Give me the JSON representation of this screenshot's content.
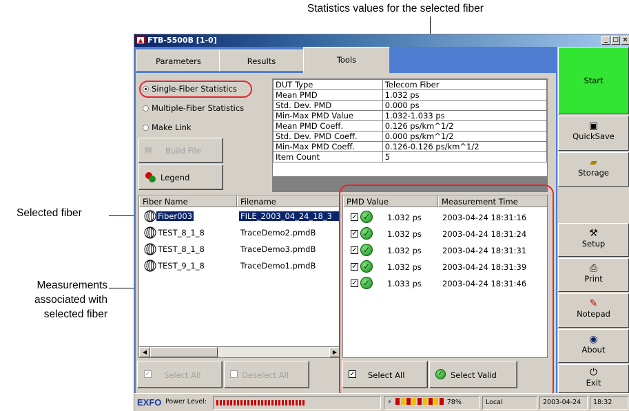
{
  "annotations": {
    "top": "Statistics values for the selected fiber",
    "selected_fiber": "Selected fiber",
    "measurements": [
      "Measurements",
      "associated with",
      "selected fiber"
    ]
  },
  "window": {
    "title": "FTB-5500B [1-0]",
    "app_icon": "exfo-app-icon",
    "controls": [
      "_",
      "□",
      "×"
    ]
  },
  "tabs": [
    {
      "label": "Parameters",
      "active": false
    },
    {
      "label": "Results",
      "active": false
    },
    {
      "label": "Tools",
      "active": true
    }
  ],
  "options": {
    "single": "Single-Fiber Statistics",
    "multiple": "Multiple-Fiber Statistics",
    "link": "Make Link",
    "selected": "single"
  },
  "buttons": {
    "build_file": "Build File",
    "legend": "Legend",
    "select_all_left": "Select All",
    "deselect_all": "Deselect All",
    "select_all": "Select All",
    "select_valid": "Select Valid"
  },
  "stats": [
    {
      "key": "DUT Type",
      "value": "Telecom Fiber"
    },
    {
      "key": "Mean PMD",
      "value": "1.032 ps"
    },
    {
      "key": "Std. Dev. PMD",
      "value": "0.000 ps"
    },
    {
      "key": "Min-Max PMD Value",
      "value": "1.032-1.033 ps"
    },
    {
      "key": "Mean PMD Coeff.",
      "value": "0.126 ps/km^1/2"
    },
    {
      "key": "Std. Dev. PMD Coeff.",
      "value": "0.000 ps/km^1/2"
    },
    {
      "key": "Min-Max PMD Coeff.",
      "value": "0.126-0.126 ps/km^1/2"
    },
    {
      "key": "Item Count",
      "value": "5"
    }
  ],
  "fiber_list": {
    "headers": [
      "Fiber Name",
      "Filename"
    ],
    "rows": [
      {
        "name": "Fiber003",
        "file": "FILE_2003_04_24_18_3",
        "selected": true
      },
      {
        "name": "TEST_8_1_8",
        "file": "TraceDemo2.pmdB",
        "selected": false
      },
      {
        "name": "TEST_8_1_8",
        "file": "TraceDemo3.pmdB",
        "selected": false
      },
      {
        "name": "TEST_9_1_8",
        "file": "TraceDemo1.pmdB",
        "selected": false
      }
    ]
  },
  "measurements": {
    "headers": [
      "PMD Value",
      "Measurement Time"
    ],
    "rows": [
      {
        "checked": true,
        "value": "1.032 ps",
        "time": "2003-04-24 18:31:16"
      },
      {
        "checked": true,
        "value": "1.032 ps",
        "time": "2003-04-24 18:31:24"
      },
      {
        "checked": true,
        "value": "1.032 ps",
        "time": "2003-04-24 18:31:31"
      },
      {
        "checked": true,
        "value": "1.032 ps",
        "time": "2003-04-24 18:31:39"
      },
      {
        "checked": true,
        "value": "1.033 ps",
        "time": "2003-04-24 18:31:46"
      }
    ]
  },
  "sidebar": {
    "start": "Start",
    "quicksave": "QuickSave",
    "storage": "Storage",
    "setup": "Setup",
    "print": "Print",
    "notepad": "Notepad",
    "about": "About",
    "exit": "Exit"
  },
  "statusbar": {
    "logo": "EXFO",
    "power_label": "Power Level:",
    "power_level_fraction": 0.55,
    "battery_percent": "78%",
    "mode": "Local",
    "date": "2003-04-24",
    "time": "18:32"
  },
  "colors": {
    "start_green": "#33e533",
    "tab_blue": "#4f7dd1",
    "highlight_red": "#e3272f",
    "selection_navy": "#0a246a"
  }
}
